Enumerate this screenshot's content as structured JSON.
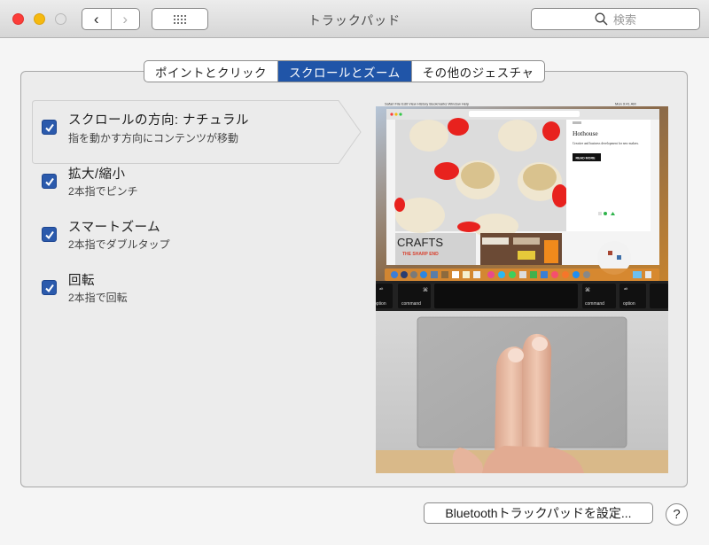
{
  "window": {
    "title": "トラックパッド",
    "search_placeholder": "検索",
    "nav_back": "‹",
    "nav_forward": "›",
    "icons": {
      "back": "chevron-left-icon",
      "forward": "chevron-right-icon",
      "grid": "show-all-grid-icon",
      "search": "magnifier-icon"
    }
  },
  "tabs": [
    {
      "label": "ポイントとクリック",
      "active": false
    },
    {
      "label": "スクロールとズーム",
      "active": true
    },
    {
      "label": "その他のジェスチャ",
      "active": false
    }
  ],
  "options": [
    {
      "title": "スクロールの方向: ナチュラル",
      "subtitle": "指を動かす方向にコンテンツが移動",
      "checked": true,
      "selected": true
    },
    {
      "title": "拡大/縮小",
      "subtitle": "2本指でピンチ",
      "checked": true,
      "selected": false
    },
    {
      "title": "スマートズーム",
      "subtitle": "2本指でダブルタップ",
      "checked": true,
      "selected": false
    },
    {
      "title": "回転",
      "subtitle": "2本指で回転",
      "checked": true,
      "selected": false
    }
  ],
  "preview": {
    "menubar": [
      "Safari",
      "File",
      "Edit",
      "View",
      "History",
      "Bookmarks",
      "Window",
      "Help"
    ],
    "clock": "Mon 9:41 AM",
    "site_heading": "Hothouse",
    "site_text": "Creative and business development for new makers.",
    "site_button": "READ MORE",
    "crafts_title": "CRAFTS",
    "crafts_sub": "THE SHARP END",
    "keys": {
      "option": "option",
      "command": "command",
      "alt": "alt",
      "cmd_symbol": "⌘"
    }
  },
  "footer": {
    "bluetooth_button": "Bluetoothトラックパッドを設定...",
    "help_button": "?"
  },
  "colors": {
    "accent": "#2055a8",
    "checkbox": "#2b5aac",
    "close": "#fc3d39",
    "minimize": "#f5b90f"
  }
}
